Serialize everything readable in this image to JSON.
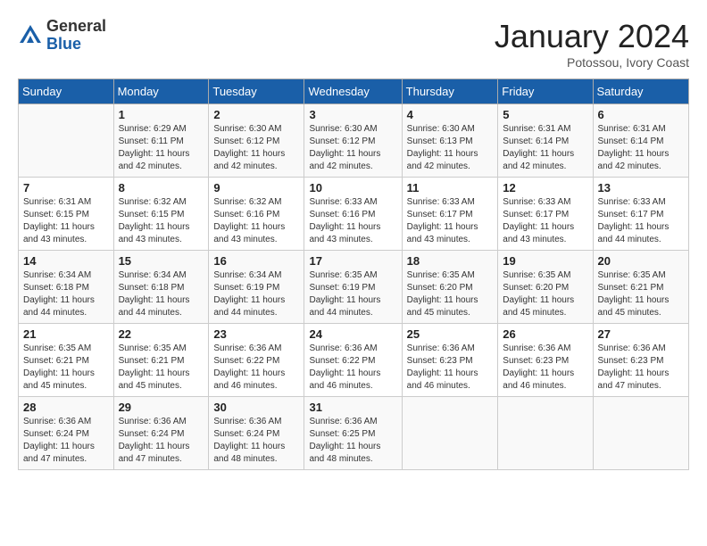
{
  "logo": {
    "general": "General",
    "blue": "Blue"
  },
  "title": "January 2024",
  "subtitle": "Potossou, Ivory Coast",
  "days_of_week": [
    "Sunday",
    "Monday",
    "Tuesday",
    "Wednesday",
    "Thursday",
    "Friday",
    "Saturday"
  ],
  "weeks": [
    [
      {
        "day": "",
        "info": ""
      },
      {
        "day": "1",
        "info": "Sunrise: 6:29 AM\nSunset: 6:11 PM\nDaylight: 11 hours\nand 42 minutes."
      },
      {
        "day": "2",
        "info": "Sunrise: 6:30 AM\nSunset: 6:12 PM\nDaylight: 11 hours\nand 42 minutes."
      },
      {
        "day": "3",
        "info": "Sunrise: 6:30 AM\nSunset: 6:12 PM\nDaylight: 11 hours\nand 42 minutes."
      },
      {
        "day": "4",
        "info": "Sunrise: 6:30 AM\nSunset: 6:13 PM\nDaylight: 11 hours\nand 42 minutes."
      },
      {
        "day": "5",
        "info": "Sunrise: 6:31 AM\nSunset: 6:14 PM\nDaylight: 11 hours\nand 42 minutes."
      },
      {
        "day": "6",
        "info": "Sunrise: 6:31 AM\nSunset: 6:14 PM\nDaylight: 11 hours\nand 42 minutes."
      }
    ],
    [
      {
        "day": "7",
        "info": "Sunrise: 6:31 AM\nSunset: 6:15 PM\nDaylight: 11 hours\nand 43 minutes."
      },
      {
        "day": "8",
        "info": "Sunrise: 6:32 AM\nSunset: 6:15 PM\nDaylight: 11 hours\nand 43 minutes."
      },
      {
        "day": "9",
        "info": "Sunrise: 6:32 AM\nSunset: 6:16 PM\nDaylight: 11 hours\nand 43 minutes."
      },
      {
        "day": "10",
        "info": "Sunrise: 6:33 AM\nSunset: 6:16 PM\nDaylight: 11 hours\nand 43 minutes."
      },
      {
        "day": "11",
        "info": "Sunrise: 6:33 AM\nSunset: 6:17 PM\nDaylight: 11 hours\nand 43 minutes."
      },
      {
        "day": "12",
        "info": "Sunrise: 6:33 AM\nSunset: 6:17 PM\nDaylight: 11 hours\nand 43 minutes."
      },
      {
        "day": "13",
        "info": "Sunrise: 6:33 AM\nSunset: 6:17 PM\nDaylight: 11 hours\nand 44 minutes."
      }
    ],
    [
      {
        "day": "14",
        "info": "Sunrise: 6:34 AM\nSunset: 6:18 PM\nDaylight: 11 hours\nand 44 minutes."
      },
      {
        "day": "15",
        "info": "Sunrise: 6:34 AM\nSunset: 6:18 PM\nDaylight: 11 hours\nand 44 minutes."
      },
      {
        "day": "16",
        "info": "Sunrise: 6:34 AM\nSunset: 6:19 PM\nDaylight: 11 hours\nand 44 minutes."
      },
      {
        "day": "17",
        "info": "Sunrise: 6:35 AM\nSunset: 6:19 PM\nDaylight: 11 hours\nand 44 minutes."
      },
      {
        "day": "18",
        "info": "Sunrise: 6:35 AM\nSunset: 6:20 PM\nDaylight: 11 hours\nand 45 minutes."
      },
      {
        "day": "19",
        "info": "Sunrise: 6:35 AM\nSunset: 6:20 PM\nDaylight: 11 hours\nand 45 minutes."
      },
      {
        "day": "20",
        "info": "Sunrise: 6:35 AM\nSunset: 6:21 PM\nDaylight: 11 hours\nand 45 minutes."
      }
    ],
    [
      {
        "day": "21",
        "info": "Sunrise: 6:35 AM\nSunset: 6:21 PM\nDaylight: 11 hours\nand 45 minutes."
      },
      {
        "day": "22",
        "info": "Sunrise: 6:35 AM\nSunset: 6:21 PM\nDaylight: 11 hours\nand 45 minutes."
      },
      {
        "day": "23",
        "info": "Sunrise: 6:36 AM\nSunset: 6:22 PM\nDaylight: 11 hours\nand 46 minutes."
      },
      {
        "day": "24",
        "info": "Sunrise: 6:36 AM\nSunset: 6:22 PM\nDaylight: 11 hours\nand 46 minutes."
      },
      {
        "day": "25",
        "info": "Sunrise: 6:36 AM\nSunset: 6:23 PM\nDaylight: 11 hours\nand 46 minutes."
      },
      {
        "day": "26",
        "info": "Sunrise: 6:36 AM\nSunset: 6:23 PM\nDaylight: 11 hours\nand 46 minutes."
      },
      {
        "day": "27",
        "info": "Sunrise: 6:36 AM\nSunset: 6:23 PM\nDaylight: 11 hours\nand 47 minutes."
      }
    ],
    [
      {
        "day": "28",
        "info": "Sunrise: 6:36 AM\nSunset: 6:24 PM\nDaylight: 11 hours\nand 47 minutes."
      },
      {
        "day": "29",
        "info": "Sunrise: 6:36 AM\nSunset: 6:24 PM\nDaylight: 11 hours\nand 47 minutes."
      },
      {
        "day": "30",
        "info": "Sunrise: 6:36 AM\nSunset: 6:24 PM\nDaylight: 11 hours\nand 48 minutes."
      },
      {
        "day": "31",
        "info": "Sunrise: 6:36 AM\nSunset: 6:25 PM\nDaylight: 11 hours\nand 48 minutes."
      },
      {
        "day": "",
        "info": ""
      },
      {
        "day": "",
        "info": ""
      },
      {
        "day": "",
        "info": ""
      }
    ]
  ]
}
